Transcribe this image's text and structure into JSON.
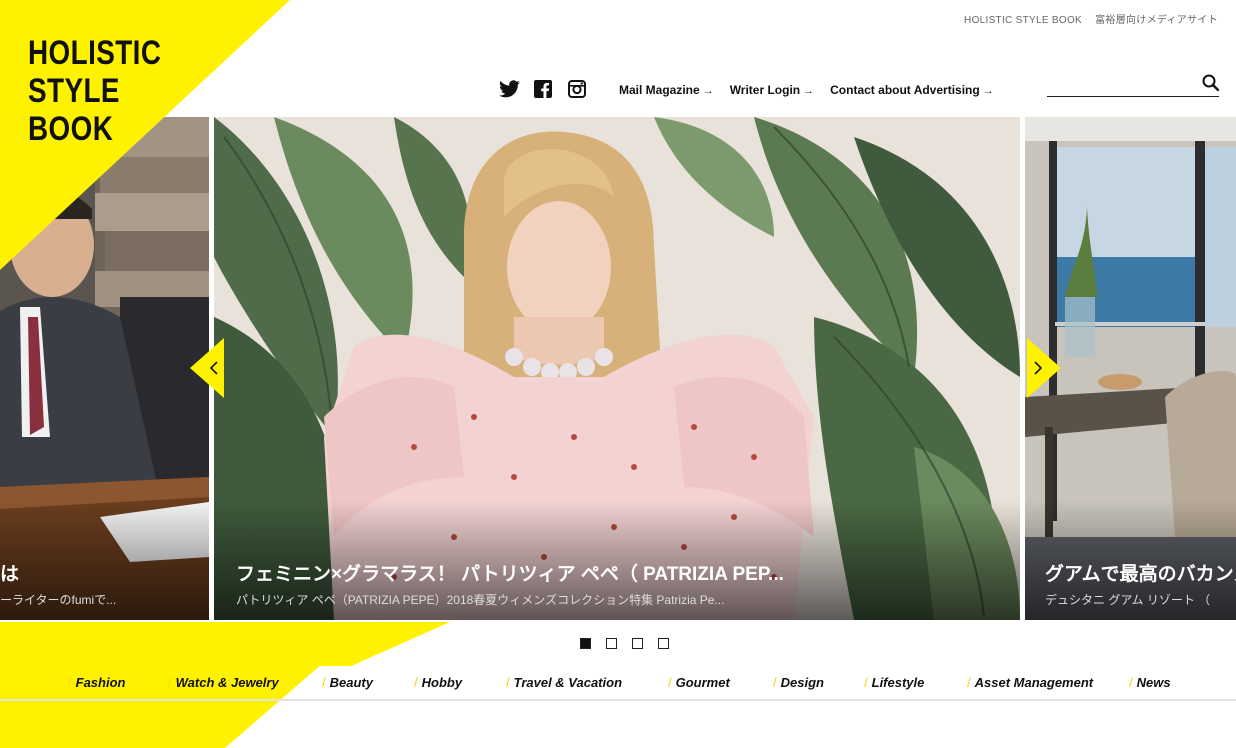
{
  "brand": {
    "logo_lines": [
      "HOLISTIC",
      "STYLE",
      "BOOK"
    ],
    "accent_color": "#fff200"
  },
  "header": {
    "tagline_en": "HOLISTIC STYLE BOOK",
    "tagline_jp": "富裕層向けメディアサイト",
    "social": [
      "twitter-icon",
      "facebook-icon",
      "instagram-icon"
    ],
    "nav": [
      {
        "label": "Mail Magazine",
        "arrow": "→"
      },
      {
        "label": "Writer Login",
        "arrow": "→"
      },
      {
        "label": "Contact about Advertising",
        "arrow": "→"
      }
    ],
    "search": {
      "placeholder": "",
      "icon": "search-icon"
    }
  },
  "slider": {
    "left": {
      "title": "は",
      "subtitle": "ーライターのfumiで..."
    },
    "main": {
      "title": "フェミニン×グラマラス！ パトリツィア ペペ（ PATRIZIA PEP...",
      "subtitle": "パトリツィア ペペ（PATRIZIA PEPE）2018春夏ウィメンズコレクション特集 Patrizia Pe..."
    },
    "right": {
      "title": "グアムで最高のバカンス",
      "subtitle": "デュシタニ グアム リゾート （"
    },
    "dots_total": 4,
    "active_dot": 1
  },
  "categories": [
    "Fashion",
    "Watch & Jewelry",
    "Beauty",
    "Hobby",
    "Travel & Vacation",
    "Gourmet",
    "Design",
    "Lifestyle",
    "Asset Management",
    "News"
  ]
}
